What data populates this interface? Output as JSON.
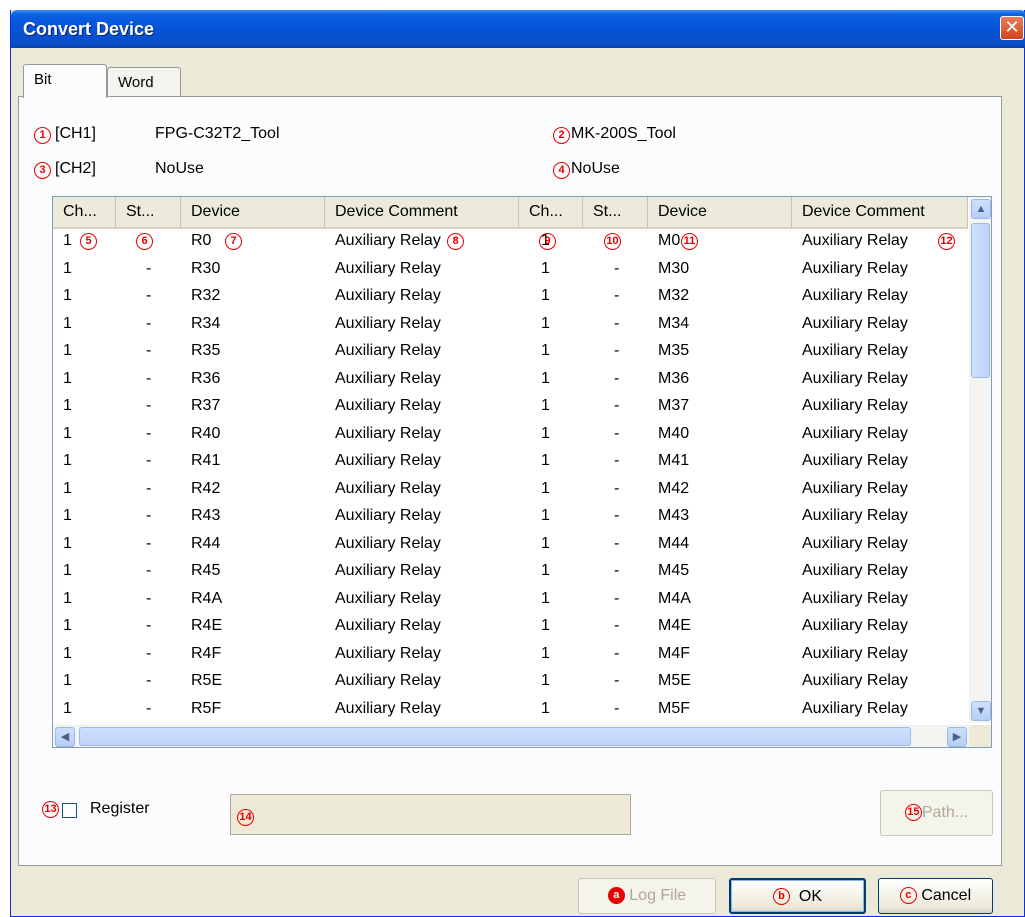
{
  "window": {
    "title": "Convert Device",
    "close_glyph": "✕"
  },
  "tabs": [
    {
      "label": "Bit",
      "active": true
    },
    {
      "label": "Word",
      "active": false
    }
  ],
  "channels": {
    "ch1_tag": "[CH1]",
    "ch1_left": "FPG-C32T2_Tool",
    "ch1_right": "MK-200S_Tool",
    "ch2_tag": "[CH2]",
    "ch2_left": "NoUse",
    "ch2_right": "NoUse"
  },
  "markers": {
    "m1": "1",
    "m2": "2",
    "m3": "3",
    "m4": "4",
    "m5": "5",
    "m6": "6",
    "m7": "7",
    "m8": "8",
    "m9": "9",
    "m10": "10",
    "m11": "11",
    "m12": "12",
    "m13": "13",
    "m14": "14",
    "m15": "15",
    "a": "a",
    "b": "b",
    "c": "c"
  },
  "table": {
    "headers": [
      "Ch...",
      "St...",
      "Device",
      "Device Comment",
      "Ch...",
      "St...",
      "Device",
      "Device Comment"
    ],
    "rows": [
      [
        "1",
        "",
        "R0",
        "Auxiliary Relay",
        "1",
        "",
        "M0",
        "Auxiliary Relay"
      ],
      [
        "1",
        "-",
        "R30",
        "Auxiliary Relay",
        "1",
        "-",
        "M30",
        "Auxiliary Relay"
      ],
      [
        "1",
        "-",
        "R32",
        "Auxiliary Relay",
        "1",
        "-",
        "M32",
        "Auxiliary Relay"
      ],
      [
        "1",
        "-",
        "R34",
        "Auxiliary Relay",
        "1",
        "-",
        "M34",
        "Auxiliary Relay"
      ],
      [
        "1",
        "-",
        "R35",
        "Auxiliary Relay",
        "1",
        "-",
        "M35",
        "Auxiliary Relay"
      ],
      [
        "1",
        "-",
        "R36",
        "Auxiliary Relay",
        "1",
        "-",
        "M36",
        "Auxiliary Relay"
      ],
      [
        "1",
        "-",
        "R37",
        "Auxiliary Relay",
        "1",
        "-",
        "M37",
        "Auxiliary Relay"
      ],
      [
        "1",
        "-",
        "R40",
        "Auxiliary Relay",
        "1",
        "-",
        "M40",
        "Auxiliary Relay"
      ],
      [
        "1",
        "-",
        "R41",
        "Auxiliary Relay",
        "1",
        "-",
        "M41",
        "Auxiliary Relay"
      ],
      [
        "1",
        "-",
        "R42",
        "Auxiliary Relay",
        "1",
        "-",
        "M42",
        "Auxiliary Relay"
      ],
      [
        "1",
        "-",
        "R43",
        "Auxiliary Relay",
        "1",
        "-",
        "M43",
        "Auxiliary Relay"
      ],
      [
        "1",
        "-",
        "R44",
        "Auxiliary Relay",
        "1",
        "-",
        "M44",
        "Auxiliary Relay"
      ],
      [
        "1",
        "-",
        "R45",
        "Auxiliary Relay",
        "1",
        "-",
        "M45",
        "Auxiliary Relay"
      ],
      [
        "1",
        "-",
        "R4A",
        "Auxiliary Relay",
        "1",
        "-",
        "M4A",
        "Auxiliary Relay"
      ],
      [
        "1",
        "-",
        "R4E",
        "Auxiliary Relay",
        "1",
        "-",
        "M4E",
        "Auxiliary Relay"
      ],
      [
        "1",
        "-",
        "R4F",
        "Auxiliary Relay",
        "1",
        "-",
        "M4F",
        "Auxiliary Relay"
      ],
      [
        "1",
        "-",
        "R5E",
        "Auxiliary Relay",
        "1",
        "-",
        "M5E",
        "Auxiliary Relay"
      ],
      [
        "1",
        "-",
        "R5F",
        "Auxiliary Relay",
        "1",
        "-",
        "M5F",
        "Auxiliary Relay"
      ]
    ]
  },
  "scrollbars": {
    "up": "▲",
    "down": "▼",
    "left": "◀",
    "right": "▶"
  },
  "register": {
    "label": "Register",
    "checked": false
  },
  "path_field": {
    "value": ""
  },
  "buttons": {
    "path": "Path...",
    "log_file": "Log File",
    "ok": "OK",
    "cancel": "Cancel"
  },
  "colors": {
    "marker_red": "#e60000",
    "title_blue": "#0553d8"
  }
}
